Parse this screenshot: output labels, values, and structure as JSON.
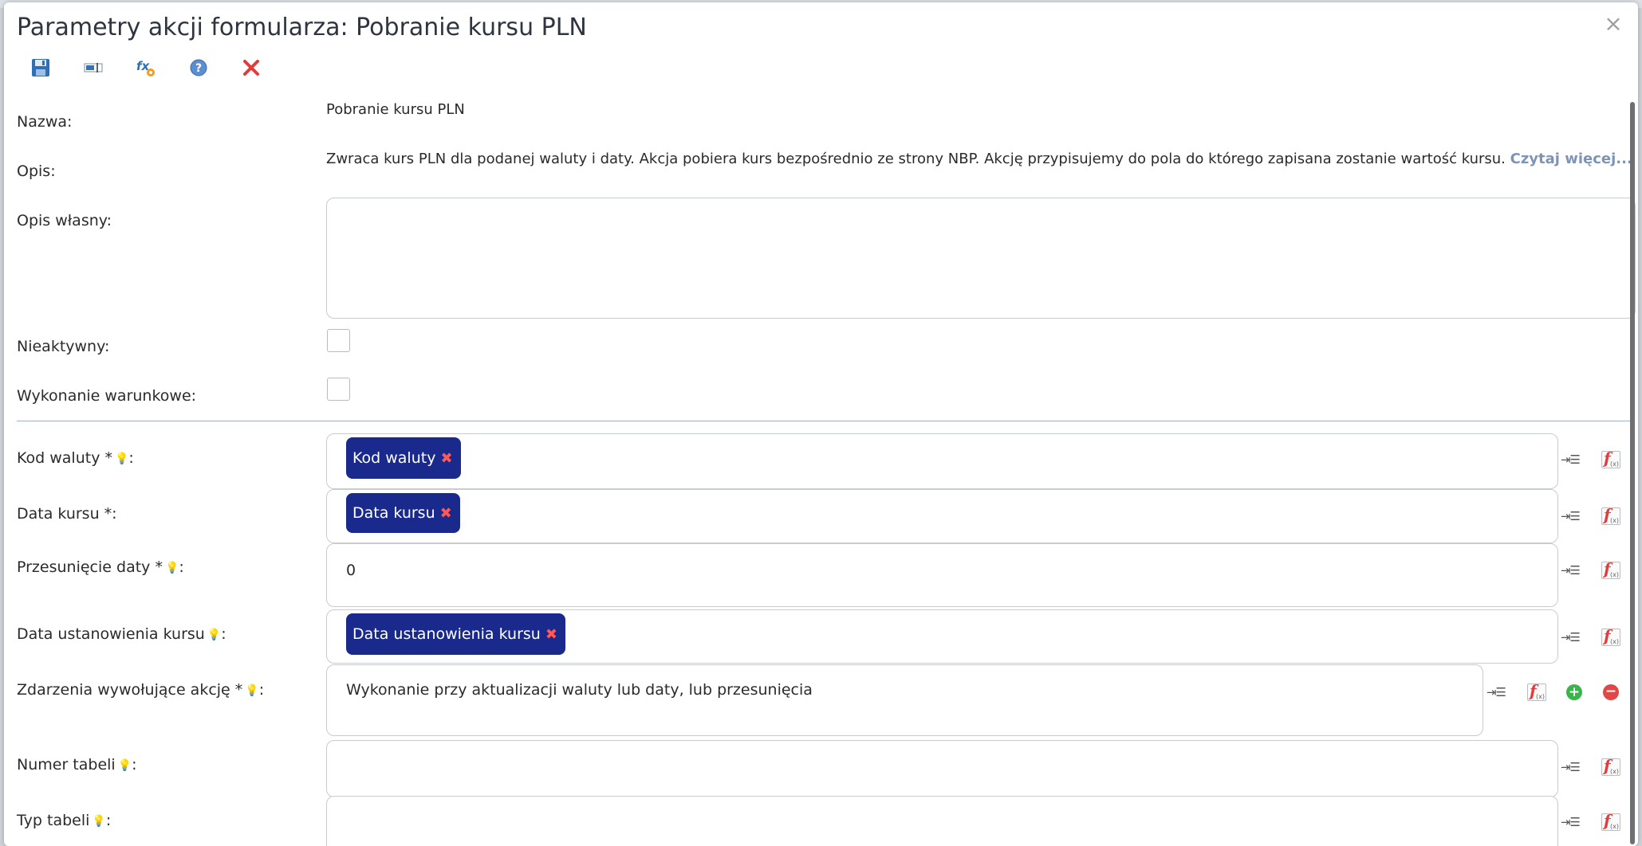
{
  "dialog": {
    "title": "Parametry akcji formularza: Pobranie kursu PLN",
    "close_glyph": "×"
  },
  "toolbar": {
    "buttons": [
      {
        "name": "save-icon"
      },
      {
        "name": "rename-icon"
      },
      {
        "name": "test-action-icon"
      },
      {
        "name": "help-icon"
      },
      {
        "name": "delete-icon"
      }
    ]
  },
  "form": {
    "name_label": "Nazwa:",
    "name_value": "Pobranie kursu PLN",
    "desc_label": "Opis:",
    "desc_text": "Zwraca kurs PLN dla podanej waluty i daty. Akcja pobiera kurs bezpośrednio ze strony NBP. Akcję przypisujemy do pola do którego zapisana zostanie wartość kursu.",
    "desc_link": "Czytaj więcej...",
    "own_desc_label": "Opis własny:",
    "inactive_label": "Nieaktywny:",
    "conditional_label": "Wykonanie warunkowe:"
  },
  "params": {
    "currency_code": {
      "label": "Kod waluty *",
      "tag": "Kod waluty"
    },
    "rate_date": {
      "label": "Data kursu *:",
      "tag": "Data kursu"
    },
    "date_shift": {
      "label": "Przesunięcie daty *",
      "value": "0"
    },
    "rate_set_date": {
      "label": "Data ustanowienia kursu",
      "tag": "Data ustanowienia kursu"
    },
    "events": {
      "label": "Zdarzenia wywołujące akcję *",
      "value": "Wykonanie przy aktualizacji waluty lub daty, lub przesunięcia"
    },
    "table_number": {
      "label": "Numer tabeli",
      "value": ""
    },
    "table_type": {
      "label": "Typ tabeli",
      "value": ""
    }
  },
  "colors": {
    "tag_bg": "#1a2a8c",
    "link": "#7e94b7",
    "remove": "#ff5a5a"
  }
}
